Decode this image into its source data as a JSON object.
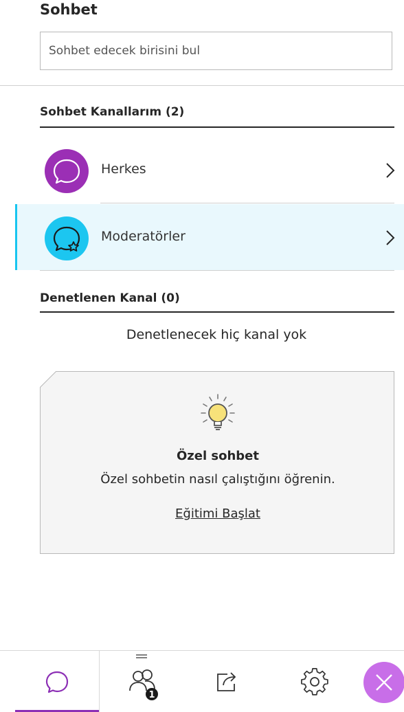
{
  "panel": {
    "title": "Sohbet",
    "search_placeholder": "Sohbet edecek birisini bul"
  },
  "my_channels": {
    "heading": "Sohbet Kanallarım (2)",
    "items": [
      {
        "label": "Herkes",
        "icon": "chat-bubble-icon",
        "color": "#9b2fb5",
        "selected": false
      },
      {
        "label": "Moderatörler",
        "icon": "moderator-chat-icon",
        "color": "#1cc6f0",
        "selected": true
      }
    ]
  },
  "monitored": {
    "heading": "Denetlenen Kanal (0)",
    "empty_text": "Denetlenecek hiç kanal yok"
  },
  "tip_card": {
    "icon": "lightbulb-icon",
    "title": "Özel sohbet",
    "description": "Özel sohbetin nasıl çalıştığını öğrenin.",
    "link": "Eğitimi Başlat"
  },
  "bottom_bar": {
    "tabs": [
      {
        "name": "chat",
        "icon": "chat-icon",
        "active": true
      },
      {
        "name": "participants",
        "icon": "participants-icon",
        "badge": "1"
      },
      {
        "name": "share",
        "icon": "share-icon"
      },
      {
        "name": "settings",
        "icon": "gear-icon"
      },
      {
        "name": "close",
        "icon": "close-icon"
      }
    ],
    "accent": "#8c2fb5"
  }
}
